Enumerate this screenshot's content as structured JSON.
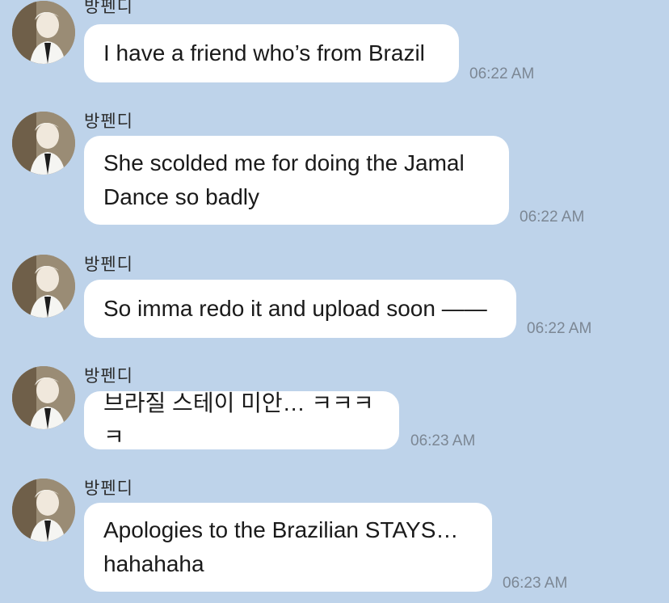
{
  "messages": [
    {
      "sender": "방펜디",
      "text": "I have a friend who’s from Brazil",
      "time": "06:22 AM"
    },
    {
      "sender": "방펜디",
      "text": "She scolded me for doing the Jamal Dance so badly",
      "time": "06:22 AM"
    },
    {
      "sender": "방펜디",
      "text": "So imma redo it and upload soon ——",
      "time": "06:22 AM"
    },
    {
      "sender": "방펜디",
      "text": "브라질 스테이 미안… ㅋㅋㅋㅋ",
      "time": "06:23 AM"
    },
    {
      "sender": "방펜디",
      "text": "Apologies to the Brazilian STAYS… hahahaha",
      "time": "06:23 AM"
    }
  ],
  "colors": {
    "background": "#bed3ea",
    "bubble": "#ffffff",
    "timestamp": "#7c8794"
  },
  "icons": {
    "avatar": "profile-photo"
  }
}
